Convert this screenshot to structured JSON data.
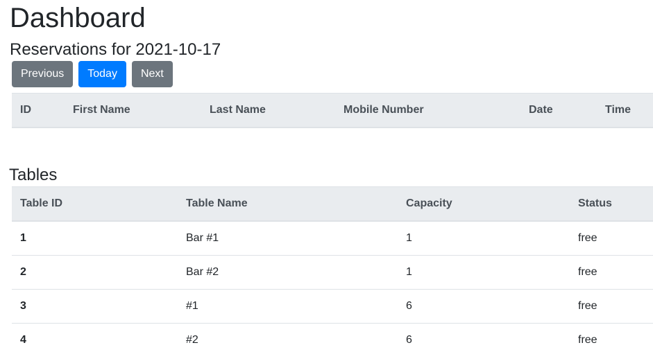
{
  "header": {
    "title": "Dashboard",
    "subtitle": "Reservations for 2021-10-17"
  },
  "date_nav": {
    "previous_label": "Previous",
    "today_label": "Today",
    "next_label": "Next"
  },
  "colors": {
    "secondary": "#6c757d",
    "primary": "#007bff",
    "table_header_bg": "#e9ecef"
  },
  "reservations": {
    "columns": [
      "ID",
      "First Name",
      "Last Name",
      "Mobile Number",
      "Date",
      "Time"
    ],
    "rows": []
  },
  "tables_section": {
    "title": "Tables",
    "columns": [
      "Table ID",
      "Table Name",
      "Capacity",
      "Status"
    ],
    "rows": [
      {
        "id": "1",
        "name": "Bar #1",
        "capacity": "1",
        "status": "free"
      },
      {
        "id": "2",
        "name": "Bar #2",
        "capacity": "1",
        "status": "free"
      },
      {
        "id": "3",
        "name": "#1",
        "capacity": "6",
        "status": "free"
      },
      {
        "id": "4",
        "name": "#2",
        "capacity": "6",
        "status": "free"
      }
    ]
  }
}
